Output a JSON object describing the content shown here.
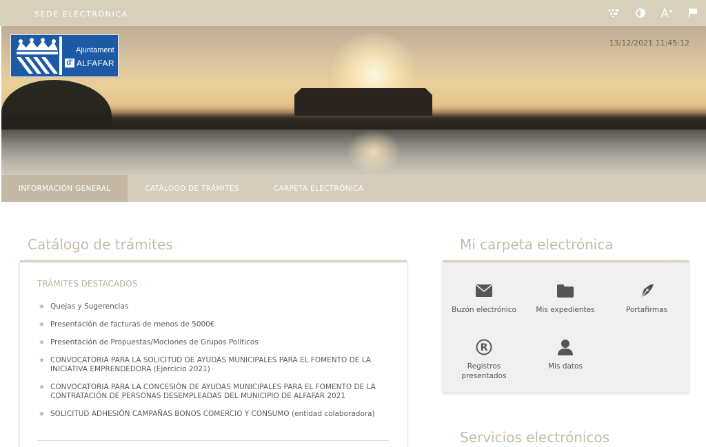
{
  "topbar": {
    "title": "SEDE ELECTRÓNICA",
    "icons": [
      "accessibility-dots-icon",
      "contrast-icon",
      "font-size-icon",
      "language-flag-icon"
    ]
  },
  "banner": {
    "logo": {
      "line1": "Ajuntament",
      "prefix": "d'",
      "line2": "ALFAFAR"
    },
    "datetime": "13/12/2021 11:45:12"
  },
  "nav": {
    "tabs": [
      {
        "label": "INFORMACIÓN GENERAL",
        "active": true
      },
      {
        "label": "CATÁLOGO DE TRÁMITES",
        "active": false
      },
      {
        "label": "CARPETA ELECTRÓNICA",
        "active": false
      }
    ]
  },
  "catalogo": {
    "title": "Catálogo de trámites",
    "heading": "TRÁMITES DESTACADOS",
    "items": [
      "Quejas y Sugerencias",
      "Presentación de facturas de menos de 5000€",
      "Presentación de Propuestas/Mociones de Grupos Políticos",
      "CONVOCATORIA PARA LA SOLICITUD DE AYUDAS MUNICIPALES PARA EL FOMENTO DE LA INICIATIVA EMPRENDEDORA (Ejercicio 2021)",
      "CONVOCATORIA PARA LA CONCESIÓN DE AYUDAS MUNICIPALES PARA EL FOMENTO DE LA CONTRATACIÓN DE PERSONAS DESEMPLEADAS DEL MUNICIPIO DE ALFAFAR 2021",
      "SOLICITUD ADHESIÓN CAMPAÑAS BONOS COMERCIO Y CONSUMO (entidad colaboradora)"
    ]
  },
  "carpeta": {
    "title": "Mi carpeta electrónica",
    "items": [
      {
        "label": "Buzón electrónico",
        "icon": "envelope-icon"
      },
      {
        "label": "Mis expedientes",
        "icon": "folder-icon"
      },
      {
        "label": "Portafirmas",
        "icon": "pen-nib-icon"
      },
      {
        "label": "Registros presentados",
        "icon": "registered-icon"
      },
      {
        "label": "Mis datos",
        "icon": "user-icon"
      }
    ]
  },
  "servicios": {
    "title": "Servicios electrónicos"
  },
  "colors": {
    "topbar": "#d8cfbd",
    "nav": "#d5ccbb",
    "nav_active": "#c2b8a5",
    "title": "#c7bba5",
    "logo_blue": "#1c5aa6"
  }
}
